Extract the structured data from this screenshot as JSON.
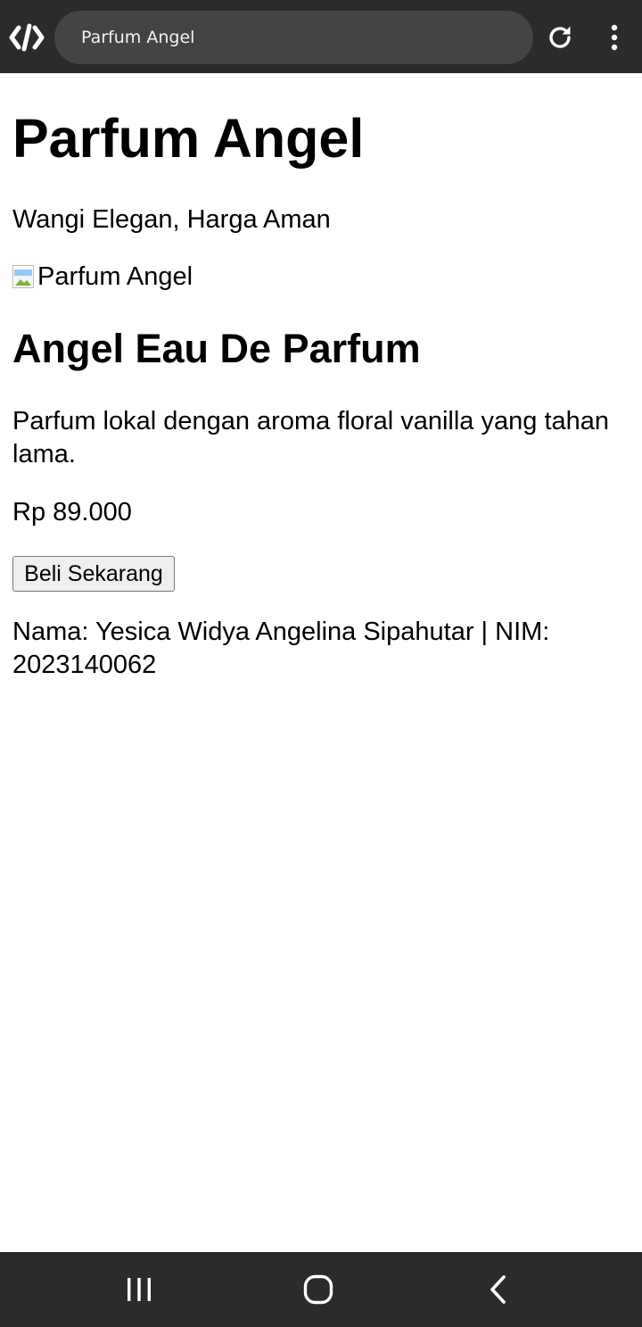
{
  "browser": {
    "url_text": "Parfum Angel",
    "icons": [
      "code-brackets-icon",
      "reload-icon",
      "more-vert-icon"
    ]
  },
  "page": {
    "title": "Parfum Angel",
    "tagline": "Wangi Elegan, Harga Aman",
    "image_alt": "Parfum Angel",
    "product_name": "Angel Eau De Parfum",
    "description": "Parfum lokal dengan aroma floral vanilla yang tahan lama.",
    "price": "Rp 89.000",
    "buy_label": "Beli Sekarang",
    "footer": "Nama: Yesica Widya Angelina Sipahutar | NIM: 2023140062"
  },
  "navbar": {
    "icons": [
      "recent-apps-icon",
      "home-icon",
      "back-icon"
    ]
  },
  "colors": {
    "chrome": "#2b2b2b",
    "urlbar": "#444444"
  }
}
